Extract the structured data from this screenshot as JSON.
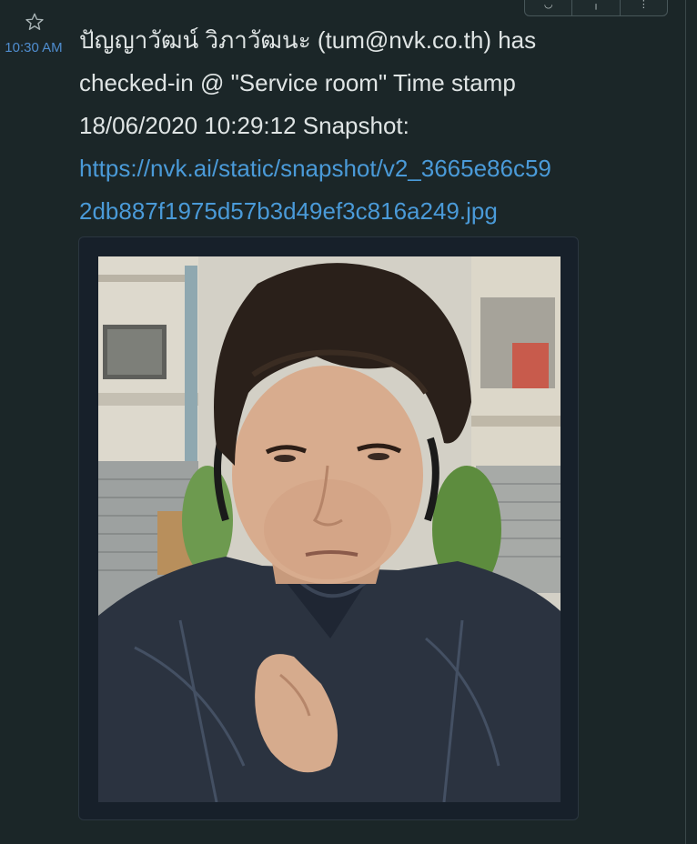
{
  "message": {
    "time": "10:30 AM",
    "lines": [
      "ปัญญาวัฒน์ วิภาวัฒนะ (tum@nvk.co.th) has",
      "checked-in @ \"Service room\" Time stamp",
      "18/06/2020 10:29:12 Snapshot:"
    ],
    "link_lines": [
      "https://nvk.ai/static/snapshot/v2_3665e86c59",
      "2db887f1975d57b3d49ef3c816a249.jpg"
    ]
  },
  "icons": {
    "star": "star-icon",
    "toolbar": [
      "emoji-reaction-icon",
      "reply-icon",
      "more-options-icon"
    ]
  },
  "colors": {
    "background": "#1b2628",
    "text": "#dfe4e4",
    "link": "#4a9ad8",
    "timestamp": "#4f8dcf"
  }
}
